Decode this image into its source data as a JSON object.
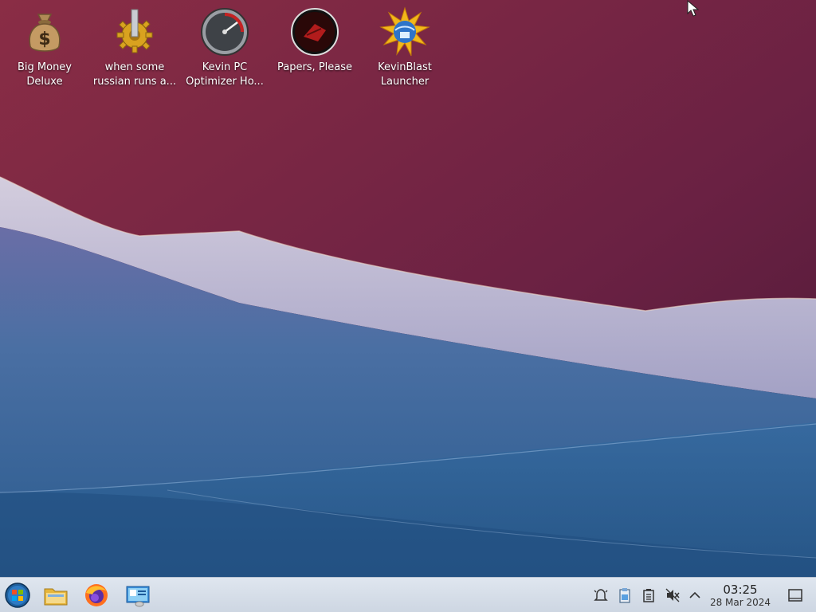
{
  "desktop": {
    "icons": [
      {
        "label": "Big Money\nDeluxe",
        "icon": "money-bag-icon"
      },
      {
        "label": "when some\nrussian runs a...",
        "icon": "gear-icon"
      },
      {
        "label": "Kevin PC\nOptimizer Ho...",
        "icon": "speedometer-icon"
      },
      {
        "label": "Papers, Please",
        "icon": "papers-please-icon"
      },
      {
        "label": "KevinBlast\nLauncher",
        "icon": "globe-burst-icon"
      }
    ]
  },
  "taskbar": {
    "start": "start-orb-icon",
    "pinned": [
      "folder-icon",
      "firefox-icon",
      "control-panel-icon"
    ],
    "tray": [
      "notifications-icon",
      "clipboard-icon",
      "battery-icon",
      "volume-muted-icon",
      "chevron-up-icon"
    ],
    "clock": {
      "time": "03:25",
      "date": "28 Mar 2024"
    },
    "show_desktop": "show-desktop-icon"
  },
  "colors": {
    "wall_top": "#7a2744",
    "wall_bottom": "#2a5b8e",
    "taskbar": "#d6dde8"
  }
}
